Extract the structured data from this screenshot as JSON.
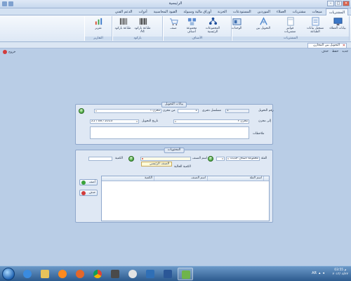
{
  "window": {
    "title": "الرئيسية"
  },
  "tabs": [
    "المشتريات",
    "مبيعات",
    "مشتريات",
    "العملاء",
    "الموردين",
    "المستودعات",
    "الخزنة",
    "أوراق مالية وسيولة",
    "القيود المحاسبية",
    "أدوات",
    "الدعم الفني"
  ],
  "ribbon": {
    "buttons": [
      {
        "label": "بيانات العملاء",
        "color": "#3b78c8"
      },
      {
        "label": "تسجيل بيانات الطباعة",
        "color": "#6f98cf"
      },
      {
        "label": "فواتير مشتريات",
        "color": "#8aa6c6"
      },
      {
        "label": "التحويل بين",
        "color": "#4a86cf"
      },
      {
        "label": "الوحدات",
        "color": "#3f6fb0"
      },
      {
        "label": "المجموعات الرئيسية",
        "color": "#1f4f9c"
      },
      {
        "label": "مجموعة أصناف",
        "color": "#5a8ad0"
      },
      {
        "label": "صنف",
        "color": "#7aa0d6"
      },
      {
        "label": "طباعة باركود A4",
        "color": "#333333"
      },
      {
        "label": "طباعة باركود",
        "color": "#555555"
      },
      {
        "label": "تقرير",
        "color": "#d85030"
      }
    ],
    "groups": [
      "المشتريات",
      "الأصناف",
      "باركود",
      "التقارير"
    ]
  },
  "doc_tab": {
    "label": "التحويل بين المخازن"
  },
  "toolbar": {
    "new": "جديد",
    "save": "حفظ",
    "delete": "حذف",
    "exit": "خروج"
  },
  "form": {
    "section1_title": "بيانات التحويل",
    "transfer_no_label": "رقم التحويل",
    "transfer_no_value": "1",
    "doc_no_label": "مسلسل دفتري",
    "doc_no_value": "1",
    "from_store_label": "من مخزن",
    "from_store_value": "مخزن ١",
    "to_store_label": "إلى مخزن",
    "to_store_value": "مخزن ٢",
    "date_label": "تاريخ التحويل",
    "date_value": "25 / 08 / 2013",
    "notes_label": "ملاحظات",
    "section2_title": "المحتويات",
    "group_label": "الفئة",
    "group_value": "مجموعة أصناف جديدة",
    "item_label": "اسم الصنف",
    "item_value": "",
    "qty_label": "الكمية",
    "qty_value": "",
    "current_qty_label": "الكمية الحالية",
    "dropdown_option": "الصنف الرئيسي",
    "grid_headers": [
      "اسم الفئة",
      "اسم الصنف",
      "الكمية"
    ],
    "add_button": "أضف",
    "delete_button": "حذف"
  },
  "taskbar": {
    "time": "03:55 م",
    "date": "٢٠١٣/٠٨/٢٢",
    "lang": "AR",
    "apps": [
      "ie",
      "explorer",
      "firefox",
      "chrome",
      "media",
      "word",
      "app",
      "app2"
    ]
  }
}
